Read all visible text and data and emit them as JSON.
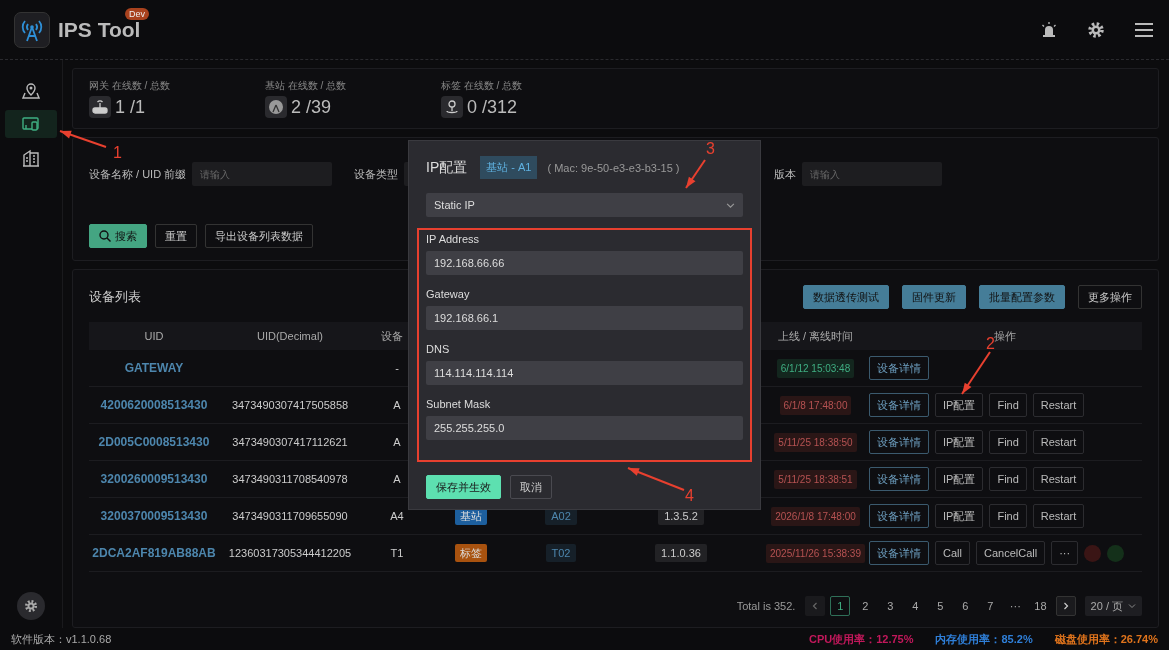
{
  "header": {
    "app_name": "IPS Tool",
    "badge": "Dev"
  },
  "sidebar": {
    "items": [
      {
        "selected": false
      },
      {
        "selected": true
      },
      {
        "selected": false
      }
    ]
  },
  "stats": [
    {
      "label": "网关 在线数 / 总数",
      "value": "1 /1"
    },
    {
      "label": "基站 在线数 / 总数",
      "value": "2 /39"
    },
    {
      "label": "标签 在线数 / 总数",
      "value": "0 /312"
    }
  ],
  "filters": {
    "name_label": "设备名称 / UID 前缀",
    "name_placeholder": "请输入",
    "type_label": "设备类型",
    "version_label": "版本",
    "version_placeholder": "请输入",
    "buttons": [
      "搜索",
      "重置",
      "导出设备列表数据"
    ]
  },
  "device_list": {
    "title": "设备列表",
    "actions": [
      {
        "label": "数据透传测试",
        "kind": "filled"
      },
      {
        "label": "固件更新",
        "kind": "filled"
      },
      {
        "label": "批量配置参数",
        "kind": "filled"
      },
      {
        "label": "更多操作",
        "kind": "outline"
      }
    ],
    "columns": [
      "UID",
      "UID(Decimal)",
      "设备",
      null,
      null,
      null,
      "上线 / 离线时间",
      "操作"
    ],
    "rows": [
      {
        "uid": "GATEWAY",
        "type": "-",
        "time": "6/1/12 15:03:48",
        "online": true,
        "actions": [
          {
            "label": "设备详情",
            "kind": "detail"
          }
        ]
      },
      {
        "uid": "4200620008513430",
        "decimal": "3473490307417505858",
        "type": "A",
        "time": "6/1/8 17:48:00",
        "online": false,
        "actions": [
          {
            "label": "设备详情",
            "kind": "detail"
          },
          {
            "label": "IP配置",
            "kind": "plain"
          },
          {
            "label": "Find",
            "kind": "plain"
          },
          {
            "label": "Restart",
            "kind": "plain"
          }
        ]
      },
      {
        "uid": "2D005C0008513430",
        "decimal": "3473490307417112621",
        "type": "A",
        "time": "5/11/25 18:38:50",
        "online": false,
        "actions": [
          {
            "label": "设备详情",
            "kind": "detail"
          },
          {
            "label": "IP配置",
            "kind": "plain"
          },
          {
            "label": "Find",
            "kind": "plain"
          },
          {
            "label": "Restart",
            "kind": "plain"
          }
        ]
      },
      {
        "uid": "3200260009513430",
        "decimal": "3473490311708540978",
        "type": "A",
        "time": "5/11/25 18:38:51",
        "online": false,
        "actions": [
          {
            "label": "设备详情",
            "kind": "detail"
          },
          {
            "label": "IP配置",
            "kind": "plain"
          },
          {
            "label": "Find",
            "kind": "plain"
          },
          {
            "label": "Restart",
            "kind": "plain"
          }
        ]
      },
      {
        "uid": "3200370009513430",
        "decimal": "3473490311709655090",
        "type": "A4",
        "tag": {
          "label": "基站",
          "color": "#1d5f9e"
        },
        "name": "A02",
        "version": "1.3.5.2",
        "time": "2026/1/8 17:48:00",
        "online": false,
        "actions": [
          {
            "label": "设备详情",
            "kind": "detail"
          },
          {
            "label": "IP配置",
            "kind": "plain"
          },
          {
            "label": "Find",
            "kind": "plain"
          },
          {
            "label": "Restart",
            "kind": "plain"
          }
        ]
      },
      {
        "uid": "2DCA2AF819AB88AB",
        "decimal": "12360317305344412205",
        "type": "T1",
        "tag": {
          "label": "标签",
          "color": "#a8520f"
        },
        "name": "T02",
        "version": "1.1.0.36",
        "time": "2025/11/26 15:38:39",
        "online": false,
        "actions": [
          {
            "label": "设备详情",
            "kind": "detail"
          },
          {
            "label": "Call",
            "kind": "plain"
          },
          {
            "label": "CancelCall",
            "kind": "plain"
          },
          {
            "label": "···",
            "kind": "plain"
          }
        ],
        "dots": [
          {
            "color": "#3a1515"
          },
          {
            "color": "#14301a"
          }
        ]
      }
    ],
    "pagination": {
      "total": "Total is 352.",
      "pages": [
        {
          "label": "1",
          "selected": true
        },
        {
          "label": "2",
          "selected": false
        },
        {
          "label": "3",
          "selected": false
        },
        {
          "label": "4",
          "selected": false
        },
        {
          "label": "5",
          "selected": false
        },
        {
          "label": "6",
          "selected": false
        },
        {
          "label": "7",
          "selected": false
        },
        {
          "label": "···",
          "selected": false
        },
        {
          "label": "18",
          "selected": false
        }
      ],
      "page_size": "20 / 页"
    }
  },
  "footer": {
    "version": "软件版本：v1.1.0.68",
    "metrics": [
      {
        "text": "CPU使用率：12.75%",
        "color": "#c2185b"
      },
      {
        "text": "内存使用率：85.2%",
        "color": "#2f7fd8"
      },
      {
        "text": "磁盘使用率：26.74%",
        "color": "#e0741c"
      }
    ]
  },
  "dialog": {
    "title": "IP配置",
    "tag": "基站 - A1",
    "mac": "( Mac: 9e-50-e3-e3-b3-15 )",
    "mode": "Static IP",
    "fields": [
      {
        "label": "IP Address",
        "value": "192.168.66.66"
      },
      {
        "label": "Gateway",
        "value": "192.168.66.1"
      },
      {
        "label": "DNS",
        "value": "114.114.114.114"
      },
      {
        "label": "Subnet Mask",
        "value": "255.255.255.0"
      }
    ],
    "buttons": [
      {
        "label": "保存并生效",
        "kind": "primary"
      },
      {
        "label": "取消",
        "kind": "default"
      }
    ]
  },
  "annotations": [
    {
      "label": "1"
    },
    {
      "label": "2"
    },
    {
      "label": "3"
    },
    {
      "label": "4"
    }
  ]
}
